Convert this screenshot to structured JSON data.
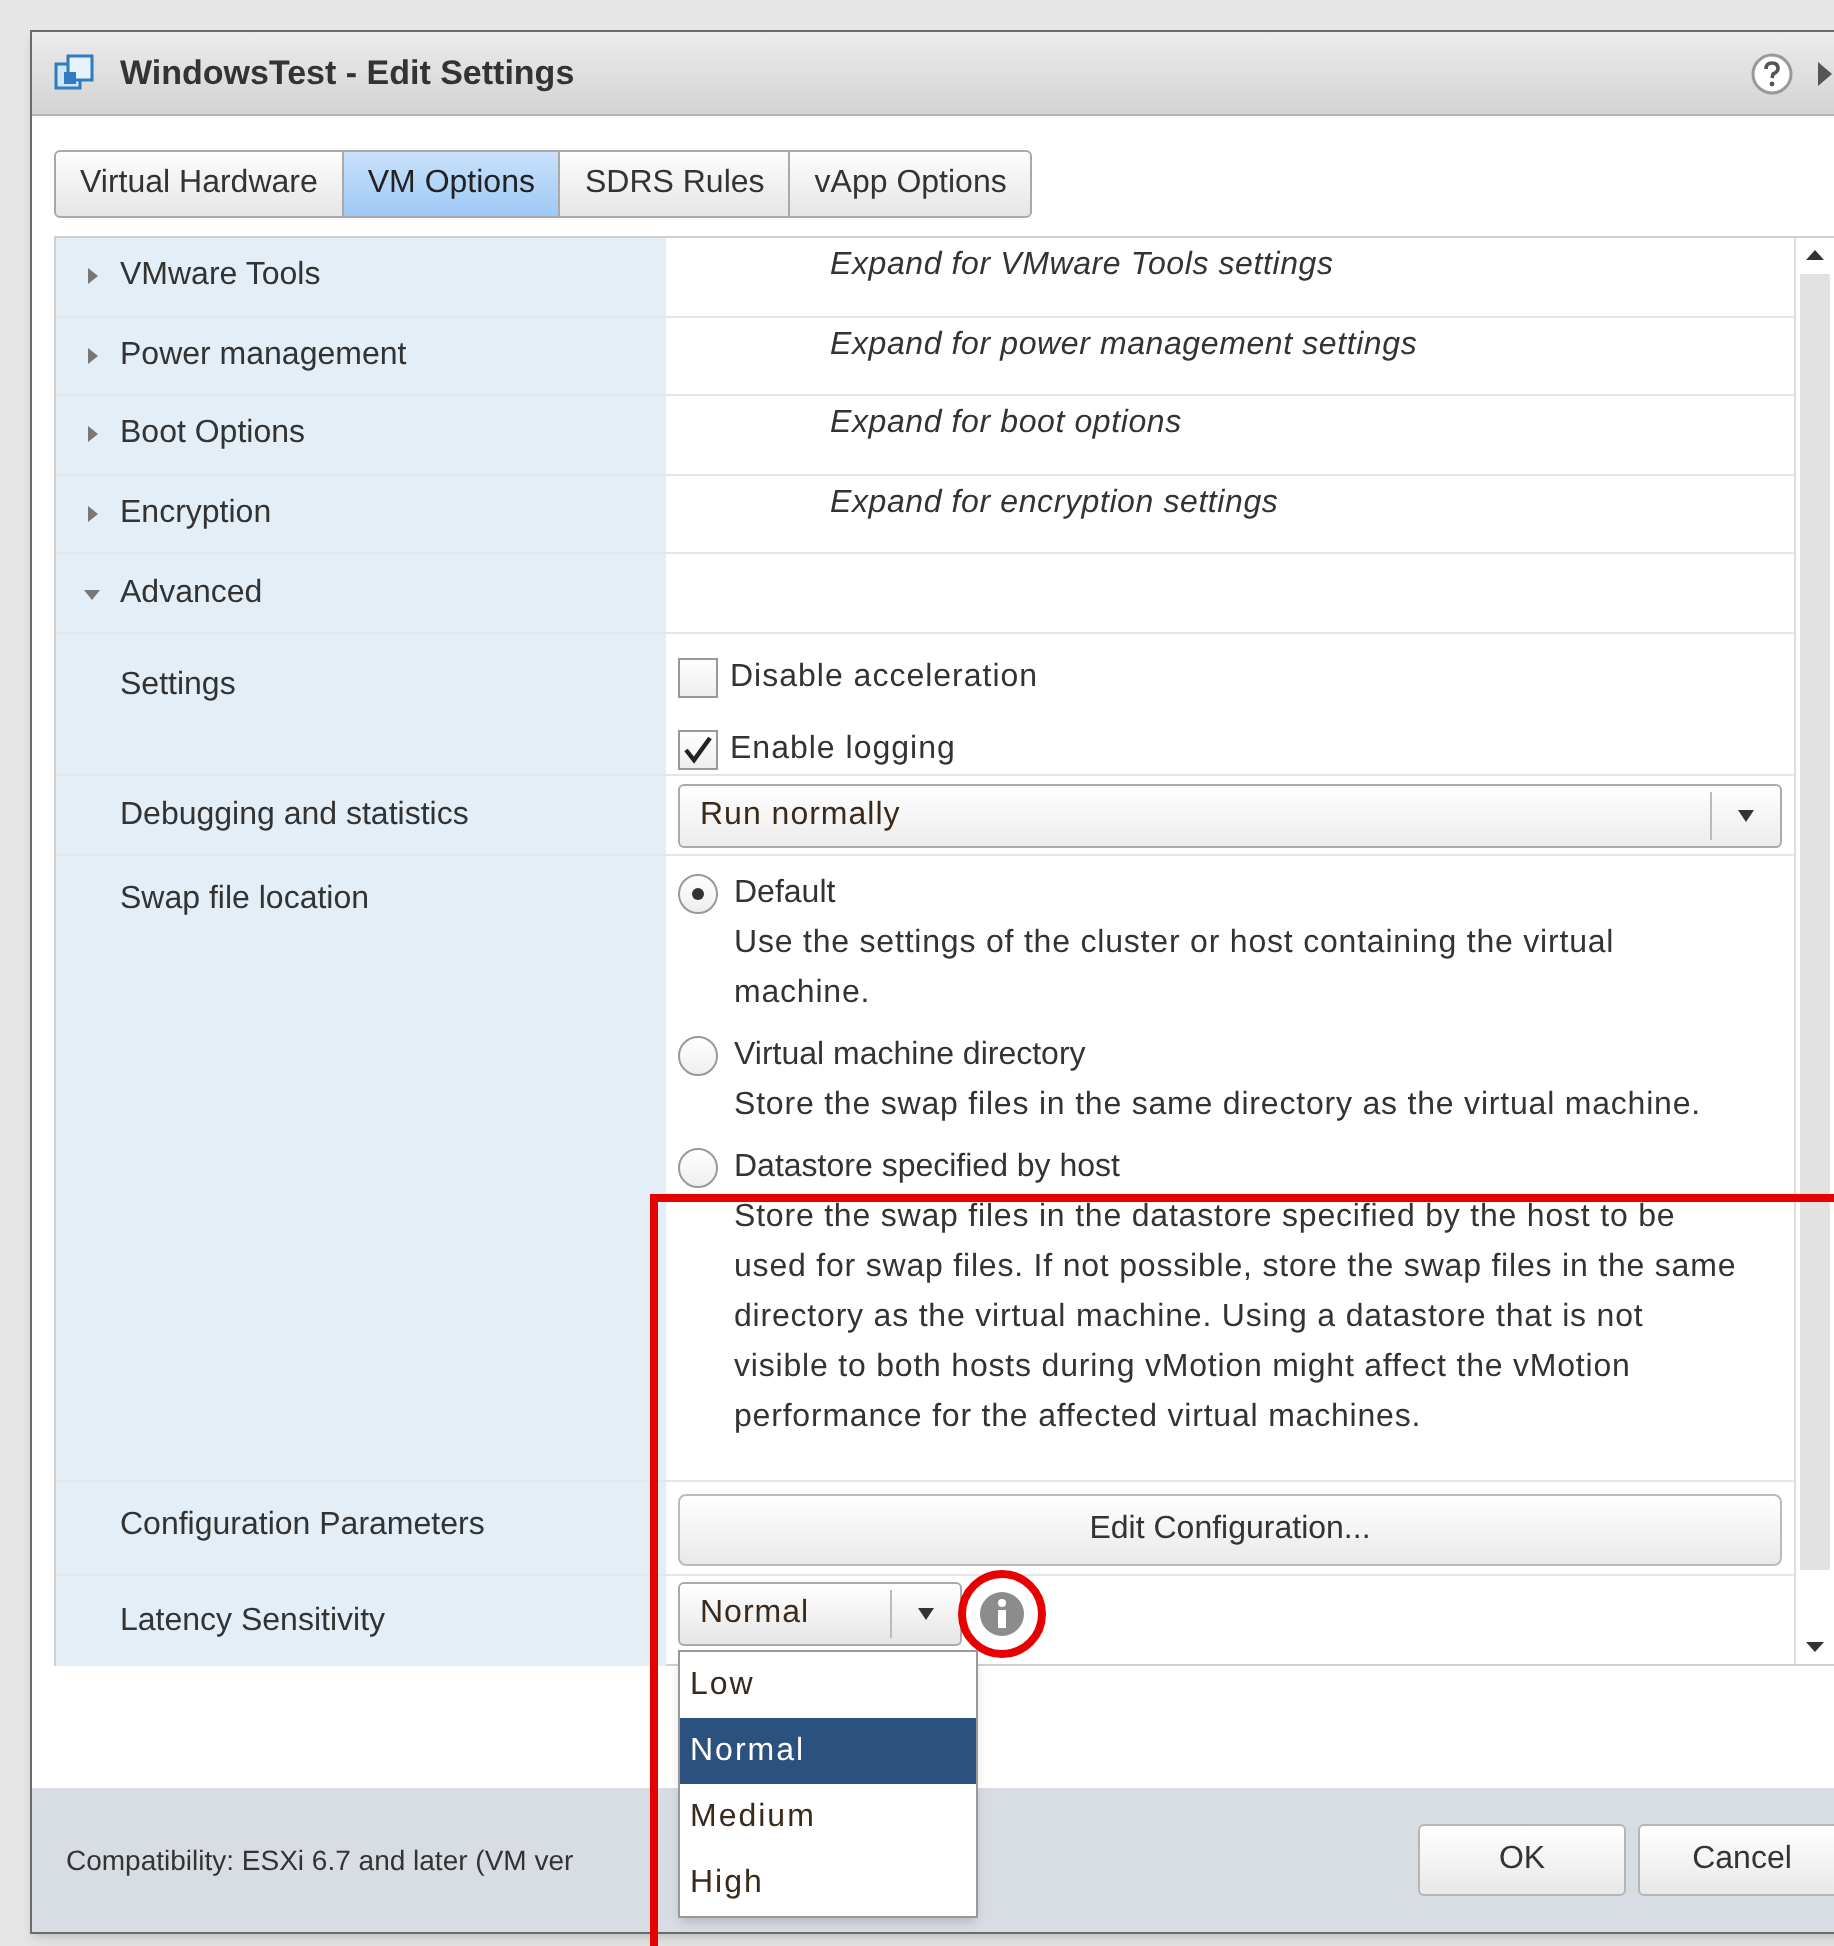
{
  "window": {
    "title": "WindowsTest - Edit Settings"
  },
  "tabs": [
    {
      "label": "Virtual Hardware",
      "selected": false
    },
    {
      "label": "VM Options",
      "selected": true
    },
    {
      "label": "SDRS Rules",
      "selected": false
    },
    {
      "label": "vApp Options",
      "selected": false
    }
  ],
  "sections": [
    {
      "label": "VMware Tools",
      "hint": "Expand for VMware Tools settings",
      "expanded": false
    },
    {
      "label": "Power management",
      "hint": "Expand for power management settings",
      "expanded": false
    },
    {
      "label": "Boot Options",
      "hint": "Expand for boot options",
      "expanded": false
    },
    {
      "label": "Encryption",
      "hint": "Expand for encryption settings",
      "expanded": false
    },
    {
      "label": "Advanced",
      "expanded": true
    }
  ],
  "advanced": {
    "settings": {
      "label": "Settings",
      "options": [
        {
          "label": "Disable acceleration",
          "checked": false
        },
        {
          "label": "Enable logging",
          "checked": true
        }
      ]
    },
    "debugging": {
      "label": "Debugging and statistics",
      "value": "Run normally"
    },
    "swap": {
      "label": "Swap file location",
      "options": [
        {
          "label": "Default",
          "description": "Use the settings of the cluster or host containing the virtual machine.",
          "selected": true
        },
        {
          "label": "Virtual machine directory",
          "description": "Store the swap files in the same directory as the virtual machine.",
          "selected": false
        },
        {
          "label": "Datastore specified by host",
          "description": "Store the swap files in the datastore specified by the host to be used for swap files. If not possible, store the swap files in the same directory as the virtual machine. Using a datastore that is not visible to both hosts during vMotion might affect the vMotion performance for the affected virtual machines.",
          "selected": false
        }
      ]
    },
    "config": {
      "label": "Configuration Parameters",
      "button": "Edit Configuration..."
    },
    "latency": {
      "label": "Latency Sensitivity",
      "value": "Normal",
      "open": true,
      "options": [
        {
          "label": "Low",
          "selected": false
        },
        {
          "label": "Normal",
          "selected": true
        },
        {
          "label": "Medium",
          "selected": false
        },
        {
          "label": "High",
          "selected": false
        }
      ]
    }
  },
  "footer": {
    "compatibility": "Compatibility: ESXi 6.7 and later (VM ver",
    "buttons": [
      "OK",
      "Cancel"
    ]
  }
}
